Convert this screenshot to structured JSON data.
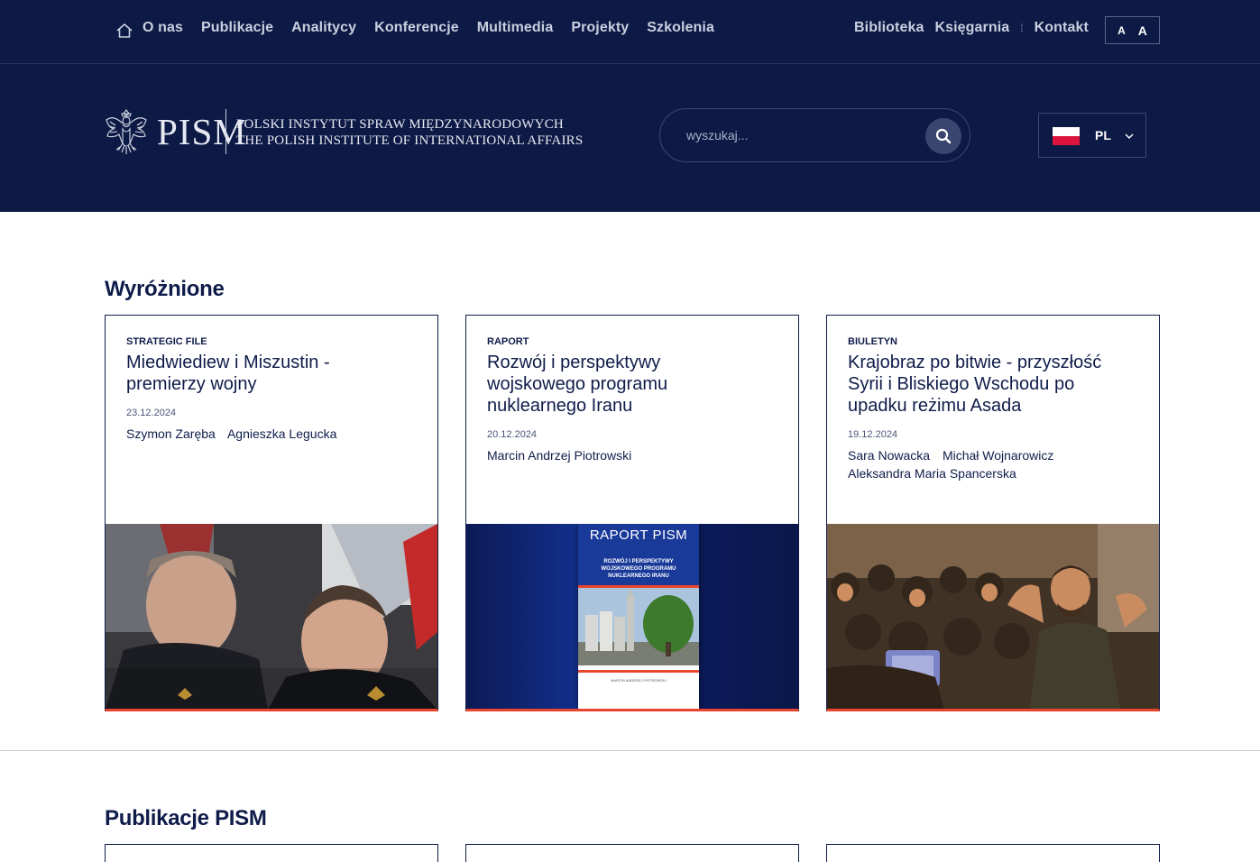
{
  "topnav": {
    "items": [
      "O nas",
      "Publikacje",
      "Analitycy",
      "Konferencje",
      "Multimedia",
      "Projekty",
      "Szkolenia"
    ],
    "right": [
      "Biblioteka",
      "Księgarnia",
      "Kontakt"
    ],
    "fontsize": [
      "A",
      "A"
    ]
  },
  "header": {
    "logo_abbr": "PISM",
    "logo_line1": "POLSKI INSTYTUT SPRAW MIĘDZYNARODOWYCH",
    "logo_line2": "THE POLISH INSTITUTE OF INTERNATIONAL AFFAIRS",
    "search_placeholder": "wyszukaj...",
    "lang": "PL"
  },
  "featured": {
    "title": "Wyróżnione",
    "cards": [
      {
        "type": "STRATEGIC FILE",
        "title": "Miedwiediew i Miszustin - premierzy wojny",
        "date": "23.12.2024",
        "authors": [
          "Szymon Zaręba",
          "Agnieszka Legucka"
        ]
      },
      {
        "type": "RAPORT",
        "title": "Rozwój i perspektywy wojskowego programu nuklearnego Iranu",
        "date": "20.12.2024",
        "authors": [
          "Marcin Andrzej Piotrowski"
        ],
        "cover_title": "RAPORT PISM",
        "cover_subtitle": "ROZWÓJ I PERSPEKTYWY WOJSKOWEGO PROGRAMU NUKLEARNEGO IRANU",
        "cover_author": "MARCIN ANDRZEJ PIOTROWSKI"
      },
      {
        "type": "BIULETYN",
        "title": "Krajobraz po bitwie - przyszłość Syrii i Bliskiego Wschodu po upadku reżimu Asada",
        "date": "19.12.2024",
        "authors": [
          "Sara Nowacka",
          "Michał Wojnarowicz",
          "Aleksandra Maria Spancerska"
        ]
      }
    ]
  },
  "publications": {
    "title": "Publikacje PISM"
  }
}
